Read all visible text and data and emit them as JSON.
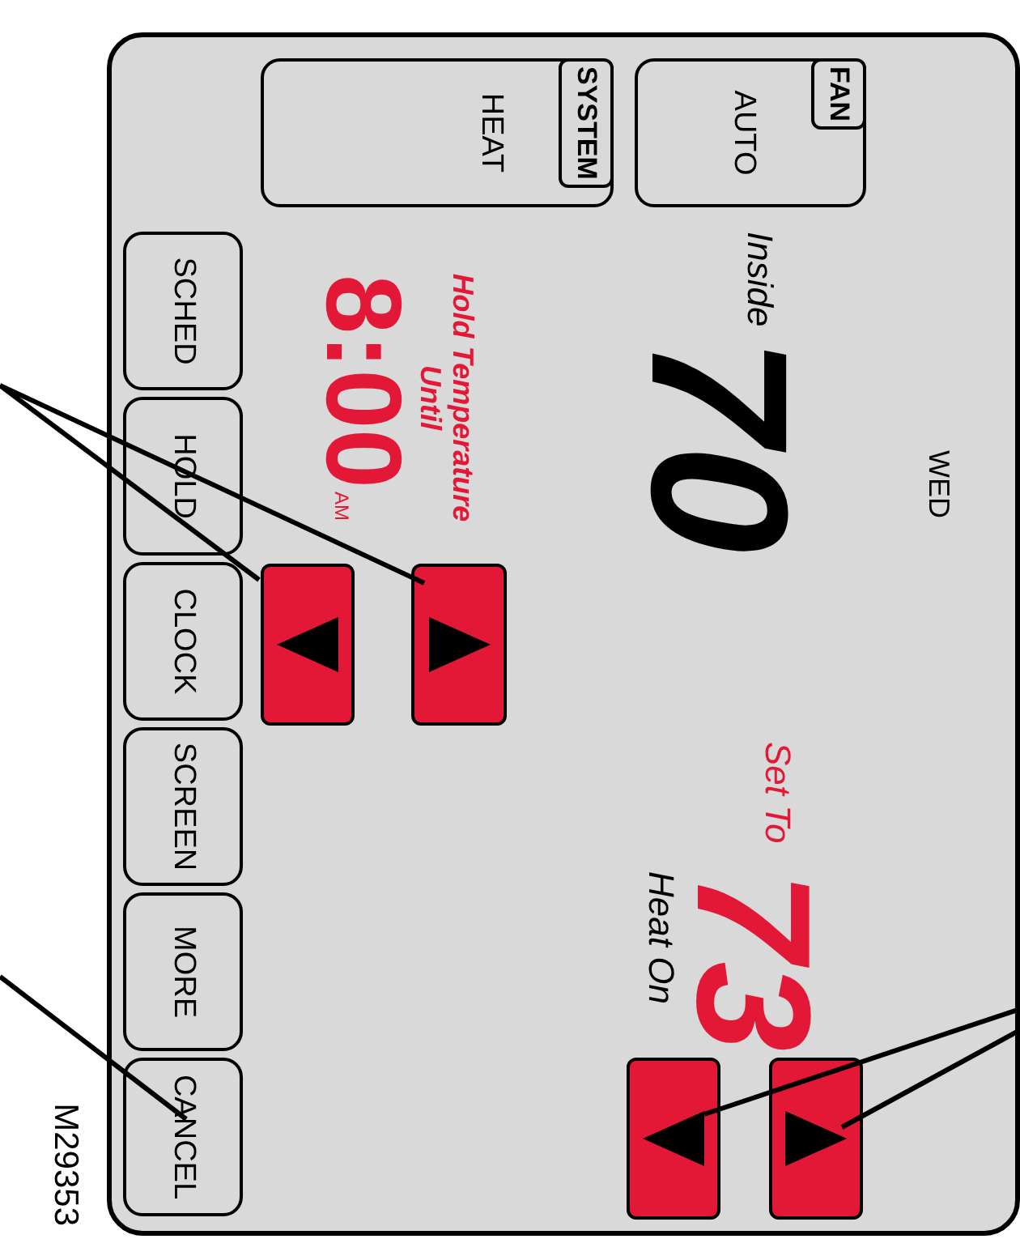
{
  "fan": {
    "label": "FAN",
    "value": "AUTO"
  },
  "system": {
    "label": "SYSTEM",
    "value": "HEAT"
  },
  "display": {
    "day": "WED",
    "inside_label": "Inside",
    "inside_temp": "70",
    "hold_label": "Hold Temperature",
    "until_label": "Until",
    "hold_time": "8:00",
    "hold_ampm": "AM",
    "set_label": "Set To",
    "set_temp": "73",
    "heat_status": "Heat On"
  },
  "buttons": [
    "SCHED",
    "HOLD",
    "CLOCK",
    "SCREEN",
    "MORE",
    "CANCEL"
  ],
  "figure_id": "M29353"
}
